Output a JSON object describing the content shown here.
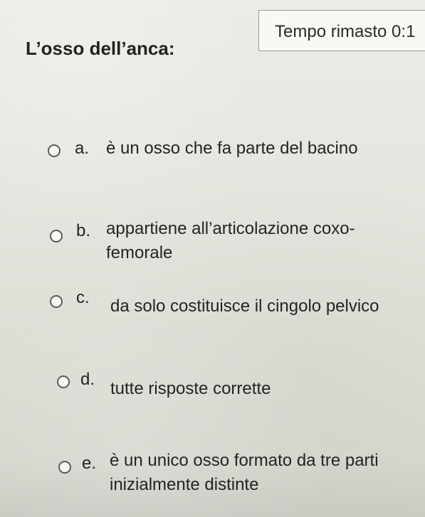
{
  "timer": {
    "label": "Tempo rimasto 0:1"
  },
  "question": {
    "title": "L’osso dell’anca:"
  },
  "options": [
    {
      "letter": "a.",
      "text": "è un osso che fa parte del bacino"
    },
    {
      "letter": "b.",
      "text": "appartiene all’articolazione coxo-femorale"
    },
    {
      "letter": "c.",
      "text": "da solo costituisce il cingolo pelvico"
    },
    {
      "letter": "d.",
      "text": "tutte risposte corrette"
    },
    {
      "letter": "e.",
      "text": "è un unico osso formato da tre parti inizialmente distinte"
    }
  ]
}
